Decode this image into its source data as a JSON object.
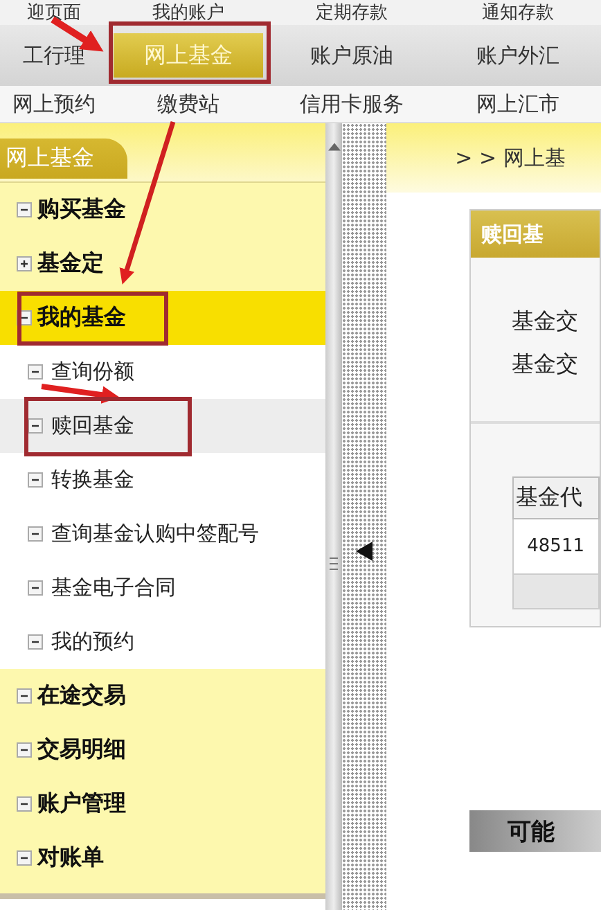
{
  "top_nav": {
    "rows": [
      [
        {
          "label": "迎页面",
          "selected": false
        },
        {
          "label": "我的账户",
          "selected": false
        },
        {
          "label": "定期存款",
          "selected": false
        },
        {
          "label": "通知存款",
          "selected": false
        }
      ],
      [
        {
          "label": "工行理",
          "selected": false
        },
        {
          "label": "网上基金",
          "selected": true
        },
        {
          "label": "账户原油",
          "selected": false
        },
        {
          "label": "账户外汇",
          "selected": false
        }
      ],
      [
        {
          "label": "网上预约",
          "selected": false
        },
        {
          "label": "缴费站",
          "selected": false
        },
        {
          "label": "信用卡服务",
          "selected": false
        },
        {
          "label": "网上汇市",
          "selected": false
        }
      ]
    ]
  },
  "sidebar": {
    "title": "网上基金",
    "items": [
      {
        "label": "购买基金",
        "expanded": true,
        "selected": false
      },
      {
        "label": "基金定",
        "expanded": false,
        "selected": false
      },
      {
        "label": "我的基金",
        "expanded": true,
        "selected": true,
        "children": [
          {
            "label": "查询份额",
            "selected": false
          },
          {
            "label": "赎回基金",
            "selected": true
          },
          {
            "label": "转换基金",
            "selected": false
          },
          {
            "label": "查询基金认购中签配号",
            "selected": false
          },
          {
            "label": "基金电子合同",
            "selected": false
          },
          {
            "label": "我的预约",
            "selected": false
          }
        ]
      },
      {
        "label": "在途交易",
        "expanded": true,
        "selected": false
      },
      {
        "label": "交易明细",
        "expanded": true,
        "selected": false
      },
      {
        "label": "账户管理",
        "expanded": true,
        "selected": false
      },
      {
        "label": "对账单",
        "expanded": true,
        "selected": false
      }
    ]
  },
  "main": {
    "breadcrumb": "> > 网上基",
    "panel_title": "赎回基",
    "fields": [
      "基金交",
      "基金交"
    ],
    "table": {
      "columns": [
        "基金代"
      ],
      "rows": [
        [
          "48511"
        ]
      ]
    },
    "next_panel_title": "可能"
  }
}
